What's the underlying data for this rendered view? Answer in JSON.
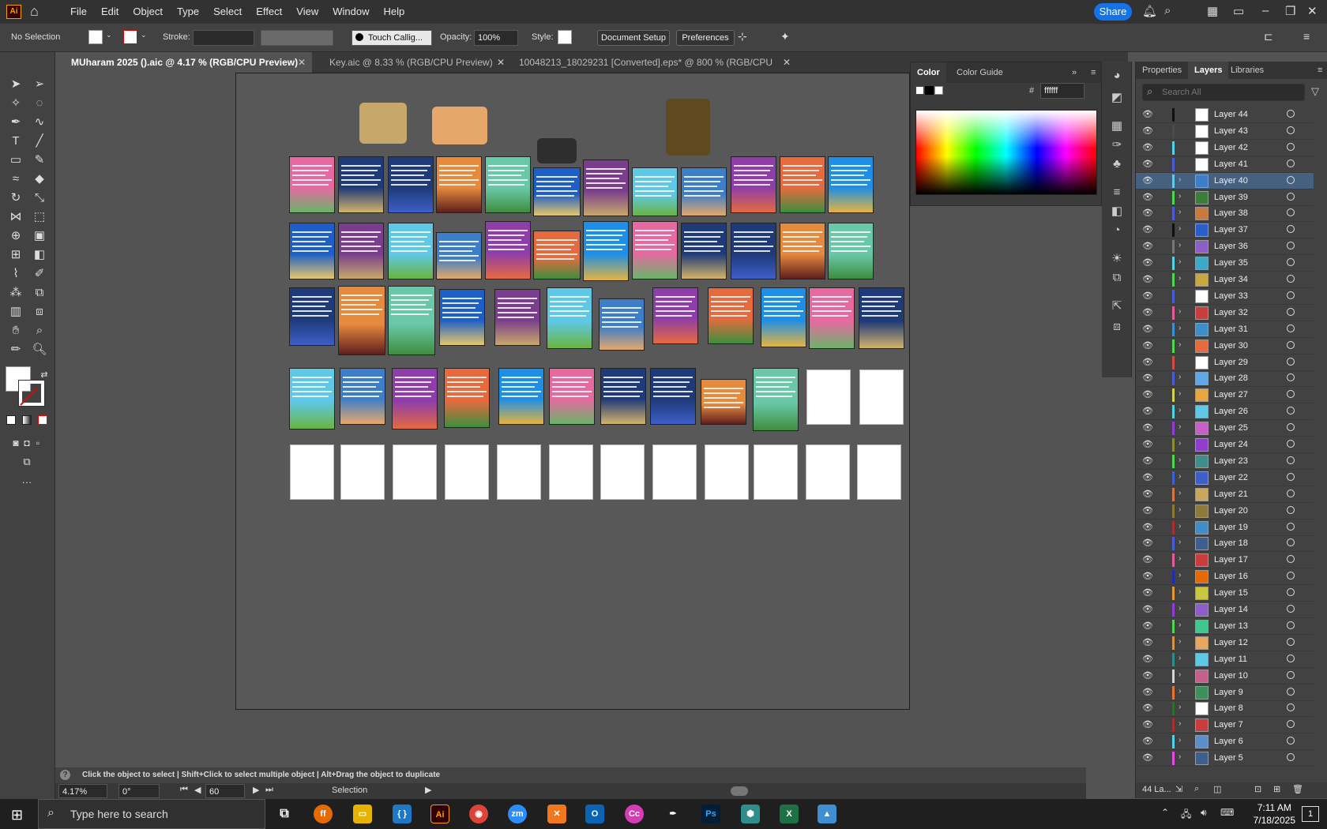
{
  "app": {
    "logo": "Ai",
    "menus": [
      "File",
      "Edit",
      "Object",
      "Type",
      "Select",
      "Effect",
      "View",
      "Window",
      "Help"
    ],
    "share_label": "Share"
  },
  "control_bar": {
    "selection": "No Selection",
    "stroke_label": "Stroke:",
    "brush": "Touch Callig...",
    "opacity_label": "Opacity:",
    "opacity_value": "100%",
    "style_label": "Style:",
    "document_setup": "Document Setup",
    "preferences": "Preferences"
  },
  "tabs": [
    {
      "label": "MUharam 2025 ().aic @ 4.17 % (RGB/CPU Preview)"
    },
    {
      "label": "Key.aic @ 8.33 % (RGB/CPU Preview)"
    },
    {
      "label": "10048213_18029231 [Converted].eps* @ 800 % (RGB/CPU Preview)"
    }
  ],
  "color_panel": {
    "tabs": [
      "Color",
      "Color Guide"
    ],
    "hash": "#",
    "hex_value": "ffffff"
  },
  "layers_panel": {
    "tabs": [
      "Properties",
      "Layers",
      "Libraries"
    ],
    "search_placeholder": "Search All",
    "footer_count": "44 La...",
    "layers": [
      {
        "name": "Layer 44",
        "color": "#111111"
      },
      {
        "name": "Layer 43",
        "color": "#4b4b4b"
      },
      {
        "name": "Layer 42",
        "color": "#4fd4e6"
      },
      {
        "name": "Layer 41",
        "color": "#4a5cd6"
      },
      {
        "name": "Layer 40",
        "color": "#5fc9ee"
      },
      {
        "name": "Layer 39",
        "color": "#4fd84f"
      },
      {
        "name": "Layer 38",
        "color": "#4a5cd6"
      },
      {
        "name": "Layer 37",
        "color": "#111111"
      },
      {
        "name": "Layer 36",
        "color": "#777777"
      },
      {
        "name": "Layer 35",
        "color": "#4fd4e6"
      },
      {
        "name": "Layer 34",
        "color": "#4fd84f"
      },
      {
        "name": "Layer 33",
        "color": "#4a5cd6"
      },
      {
        "name": "Layer 32",
        "color": "#e65a9e"
      },
      {
        "name": "Layer 31",
        "color": "#3e8ed4"
      },
      {
        "name": "Layer 30",
        "color": "#4fd84f"
      },
      {
        "name": "Layer 29",
        "color": "#d64a4a"
      },
      {
        "name": "Layer 28",
        "color": "#4a5cd6"
      },
      {
        "name": "Layer 27",
        "color": "#d4d44f"
      },
      {
        "name": "Layer 26",
        "color": "#4fd4e6"
      },
      {
        "name": "Layer 25",
        "color": "#8e3ed4"
      },
      {
        "name": "Layer 24",
        "color": "#8e8e2e"
      },
      {
        "name": "Layer 23",
        "color": "#4fd84f"
      },
      {
        "name": "Layer 22",
        "color": "#3e5ed4"
      },
      {
        "name": "Layer 21",
        "color": "#d4784a"
      },
      {
        "name": "Layer 20",
        "color": "#8e7a2e"
      },
      {
        "name": "Layer 19",
        "color": "#a83030"
      },
      {
        "name": "Layer 18",
        "color": "#4a5cd6"
      },
      {
        "name": "Layer 17",
        "color": "#e65a9e"
      },
      {
        "name": "Layer 16",
        "color": "#1e2eae"
      },
      {
        "name": "Layer 15",
        "color": "#e69a2e"
      },
      {
        "name": "Layer 14",
        "color": "#8e3ed4"
      },
      {
        "name": "Layer 13",
        "color": "#4fd84f"
      },
      {
        "name": "Layer 12",
        "color": "#d4944a"
      },
      {
        "name": "Layer 11",
        "color": "#2e8e8e"
      },
      {
        "name": "Layer 10",
        "color": "#d4d4d4"
      },
      {
        "name": "Layer 9",
        "color": "#e6782e"
      },
      {
        "name": "Layer 8",
        "color": "#2e6e2e"
      },
      {
        "name": "Layer 7",
        "color": "#a83030"
      },
      {
        "name": "Layer 6",
        "color": "#4fd4e6"
      },
      {
        "name": "Layer 5",
        "color": "#e64ae6"
      }
    ]
  },
  "hint_text": "Click the object to select  |  Shift+Click to select multiple object  |  Alt+Drag the object to duplicate",
  "status_bar": {
    "zoom": "4.17%",
    "rotation": "0°",
    "artboard": "60",
    "tool": "Selection"
  },
  "taskbar": {
    "search_placeholder": "Type here to search",
    "time": "7:11 AM",
    "date": "7/18/2025",
    "notification_count": "1"
  },
  "colors": {
    "accent": "#1473e6",
    "selected_layer": "#46607f",
    "ai_orange": "#ff9a00"
  }
}
